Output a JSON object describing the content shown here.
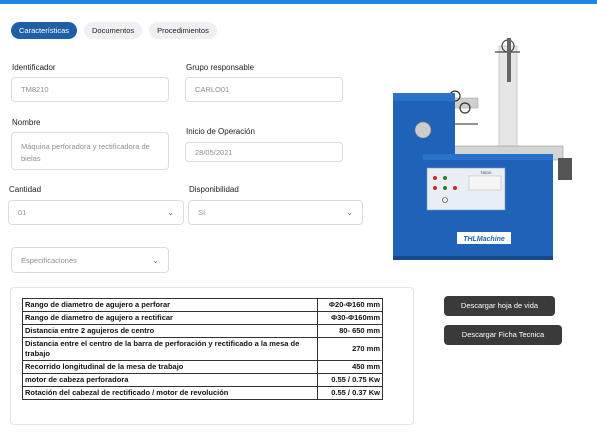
{
  "tabs": [
    {
      "label": "Características"
    },
    {
      "label": "Documentos"
    },
    {
      "label": "Procedimientos"
    }
  ],
  "form": {
    "identificador": {
      "label": "Identificador",
      "value": "TM8210"
    },
    "grupo": {
      "label": "Grupo responsable",
      "value": "CARLO01"
    },
    "nombre": {
      "label": "Nombre",
      "value": "Máquina perforadora y rectificadora de bielas"
    },
    "inicio": {
      "label": "Inicio de Operación",
      "value": "28/05/2021"
    },
    "cantidad": {
      "label": "Cantidad",
      "value": "01"
    },
    "disponibilidad": {
      "label": "Disponibilidad",
      "value": "Sí"
    },
    "especificaciones": {
      "placeholder": "Especificaciones"
    }
  },
  "machine": {
    "panel_title": "T8210",
    "brand": "THLMachine"
  },
  "specs": [
    {
      "name": "Rango de diametro de agujero a perforar",
      "value": "Φ20-Φ160 mm"
    },
    {
      "name": "Rango de diametro de agujero a rectificar",
      "value": "Φ30-Φ160mm"
    },
    {
      "name": "Distancia entre 2 agujeros de centro",
      "value": "80- 650 mm"
    },
    {
      "name": "Distancia entre el centro de la barra de perforación y rectificado a la mesa de trabajo",
      "value": "270 mm"
    },
    {
      "name": "Recorrido longitudinal de la mesa de trabajo",
      "value": "450 mm"
    },
    {
      "name": "motor de cabeza perforadora",
      "value": "0.55 / 0.75 Kw"
    },
    {
      "name": "Rotación del cabezal de rectificado / motor de revolución",
      "value": "0.55 / 0.37 Kw"
    }
  ],
  "actions": {
    "hoja_vida": "Descargar hoja de vida",
    "ficha": "Descargar Ficha Tecnica"
  },
  "colors": {
    "accent": "#1f5fa6",
    "topbar": "#1e88e5",
    "machine_blue": "#1f63b8"
  }
}
